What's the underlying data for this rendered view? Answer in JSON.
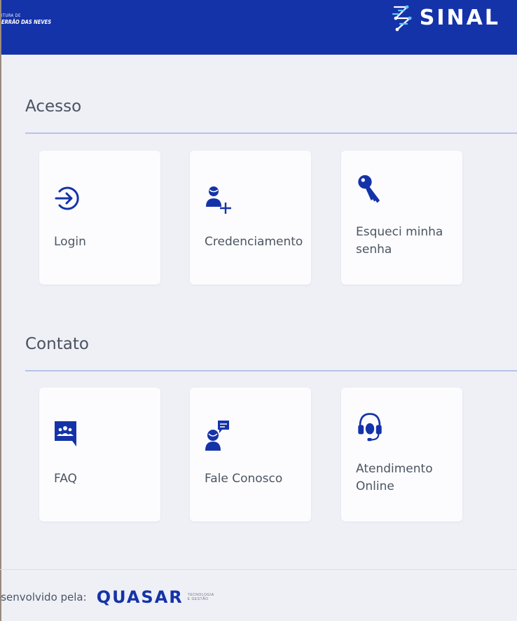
{
  "header": {
    "city_line1": "ITURA DE",
    "city_line2": "ERRÃO DAS NEVES",
    "brand": "SINAL",
    "brand_color": "#1533a8",
    "logo_icon": "sinal-logo-icon"
  },
  "sections": {
    "acesso": {
      "title": "Acesso",
      "cards": [
        {
          "label": "Login",
          "icon": "login-icon"
        },
        {
          "label": "Credenciamento",
          "icon": "add-user-icon"
        },
        {
          "label": "Esqueci minha senha",
          "icon": "key-icon"
        }
      ]
    },
    "contato": {
      "title": "Contato",
      "cards": [
        {
          "label": "FAQ",
          "icon": "faq-chat-icon"
        },
        {
          "label": "Fale Conosco",
          "icon": "user-message-icon"
        },
        {
          "label": "Atendimento Online",
          "icon": "headset-icon"
        }
      ]
    }
  },
  "footer": {
    "developed_by": "esenvolvido pela:",
    "company": "QUASAR",
    "company_tagline_1": "TECNOLOGIA",
    "company_tagline_2": "E GESTÃO"
  },
  "colors": {
    "accent": "#1533a8",
    "icon": "#1533a8",
    "background": "#eef0f6",
    "rule": "#b7c2ea",
    "card": "#fcfcfe"
  }
}
